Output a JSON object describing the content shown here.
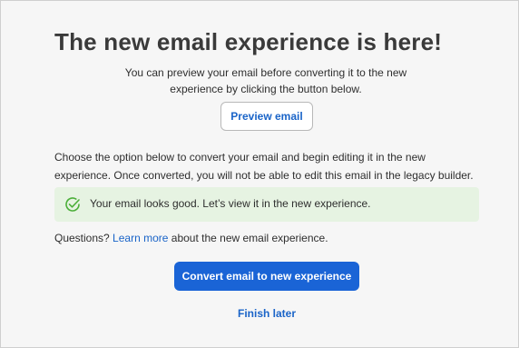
{
  "dialog": {
    "title": "The new email experience is here!",
    "intro_line1": "You can preview your email before converting it to the new",
    "intro_line2": "experience by clicking the button below.",
    "preview_button": "Preview email",
    "choose_line1": "Choose the option below to convert your email and begin editing it in the new",
    "choose_line2": "experience. Once converted, you will not be able to edit this email in the legacy builder.",
    "success_message": "Your email looks good. Let’s view it in the new experience.",
    "success_icon": "check-circle-icon",
    "questions_prefix": "Questions?",
    "questions_link": "Learn more",
    "questions_suffix": "about the new email experience.",
    "convert_button": "Convert email to new experience",
    "finish_later": "Finish later"
  },
  "colors": {
    "primary": "#1a64d6",
    "link": "#1a64c8",
    "success_bg": "#e6f3e2",
    "success_icon": "#4caf3a"
  }
}
